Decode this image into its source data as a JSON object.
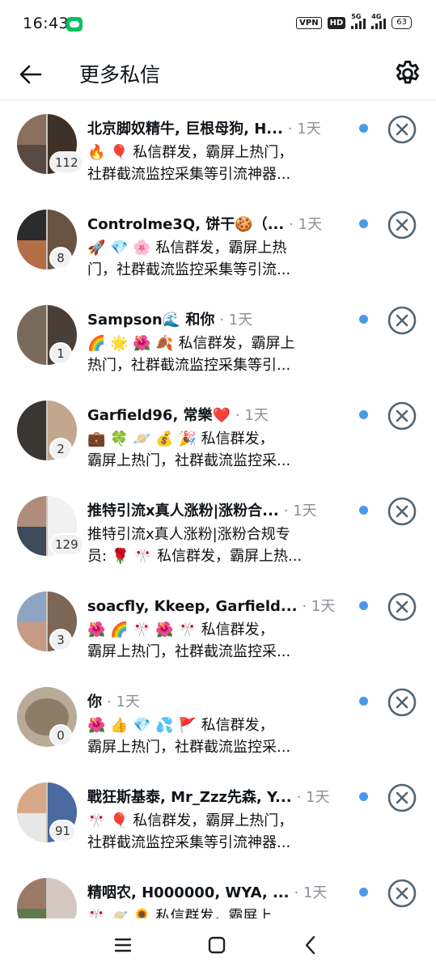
{
  "status_bar": {
    "time": "16:43",
    "vpn": "VPN",
    "hd": "HD",
    "net1": "5G",
    "net2": "4G",
    "battery": "63"
  },
  "header": {
    "title": "更多私信",
    "back_icon": "arrow-left-icon",
    "settings_icon": "gear-icon"
  },
  "colors": {
    "unread_dot": "#4a99e9",
    "dismiss_icon": "#536471",
    "badge_bg": "#eff1f3"
  },
  "conversations": [
    {
      "name": "北京脚奴精牛, 巨根母狗, H...",
      "time": "· 1天",
      "preview_line1": "🔥 🎈 私信群发，霸屏上热门，",
      "preview_line2": "社群截流监控采集等引流神器...",
      "count": "112"
    },
    {
      "name": "Controlme3Q, 饼干🍪（...",
      "time": "· 1天",
      "preview_line1": "🚀 💎 🌸 私信群发，霸屏上热",
      "preview_line2": "门，社群截流监控采集等引流...",
      "count": "8"
    },
    {
      "name": "Sampson🌊 和你",
      "time": "· 1天",
      "preview_line1": "🌈 🌟 🌺 🍂 私信群发，霸屏上",
      "preview_line2": "热门，社群截流监控采集等引...",
      "count": "1"
    },
    {
      "name": "Garfield96, 常樂❤️",
      "time": "· 1天",
      "preview_line1": "💼 🍀 🪐 💰 🎉 私信群发，",
      "preview_line2": "霸屏上热门，社群截流监控采...",
      "count": "2"
    },
    {
      "name": "推特引流x真人涨粉|涨粉合...",
      "time": "· 1天",
      "preview_line1": "推特引流x真人涨粉|涨粉合规专",
      "preview_line2": "员: 🌹 🎌 私信群发，霸屏上热...",
      "count": "129"
    },
    {
      "name": "soacfly, Kkeep, Garfield...",
      "time": "· 1天",
      "preview_line1": "🌺 🌈 🎌 🌺 🎌 私信群发，",
      "preview_line2": "霸屏上热门，社群截流监控采...",
      "count": "3"
    },
    {
      "name": "你",
      "time": "· 1天",
      "preview_line1": "🌺 👍 💎 💦 🚩 私信群发，",
      "preview_line2": "霸屏上热门，社群截流监控采...",
      "count": "0"
    },
    {
      "name": "戰狂斯基泰, Mr_Zzz先森, Y...",
      "time": "· 1天",
      "preview_line1": "🎌 🎈 私信群发，霸屏上热门，",
      "preview_line2": "社群截流监控采集等引流神器...",
      "count": "91"
    },
    {
      "name": "精咽农, H000000, WYA, ...",
      "time": "· 1天",
      "preview_line1": "🎌 🪐 🌻 私信群发，霸屏上",
      "preview_line2": "",
      "count": ""
    }
  ],
  "nav": {
    "menu_icon": "menu-icon",
    "home_icon": "home-square-icon",
    "back_icon": "chevron-left-icon"
  }
}
